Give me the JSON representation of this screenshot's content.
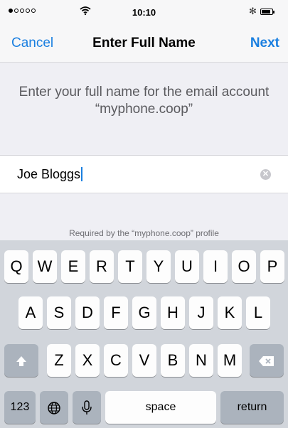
{
  "status": {
    "time": "10:10",
    "bluetooth": "✻"
  },
  "nav": {
    "cancel": "Cancel",
    "title": "Enter Full Name",
    "next": "Next"
  },
  "prompt": "Enter your full name for the email account “myphone.coop”",
  "name_field": {
    "value": "Joe Bloggs",
    "clear_icon": "✕"
  },
  "footer_note": "Required by the “myphone.coop” profile",
  "keyboard": {
    "row1": [
      "Q",
      "W",
      "E",
      "R",
      "T",
      "Y",
      "U",
      "I",
      "O",
      "P"
    ],
    "row2": [
      "A",
      "S",
      "D",
      "F",
      "G",
      "H",
      "J",
      "K",
      "L"
    ],
    "row3": [
      "Z",
      "X",
      "C",
      "V",
      "B",
      "N",
      "M"
    ],
    "numbers": "123",
    "space": "space",
    "return": "return"
  },
  "colors": {
    "accent": "#1a7fe0",
    "background": "#efeff4",
    "keyboard": "#d1d5db"
  }
}
